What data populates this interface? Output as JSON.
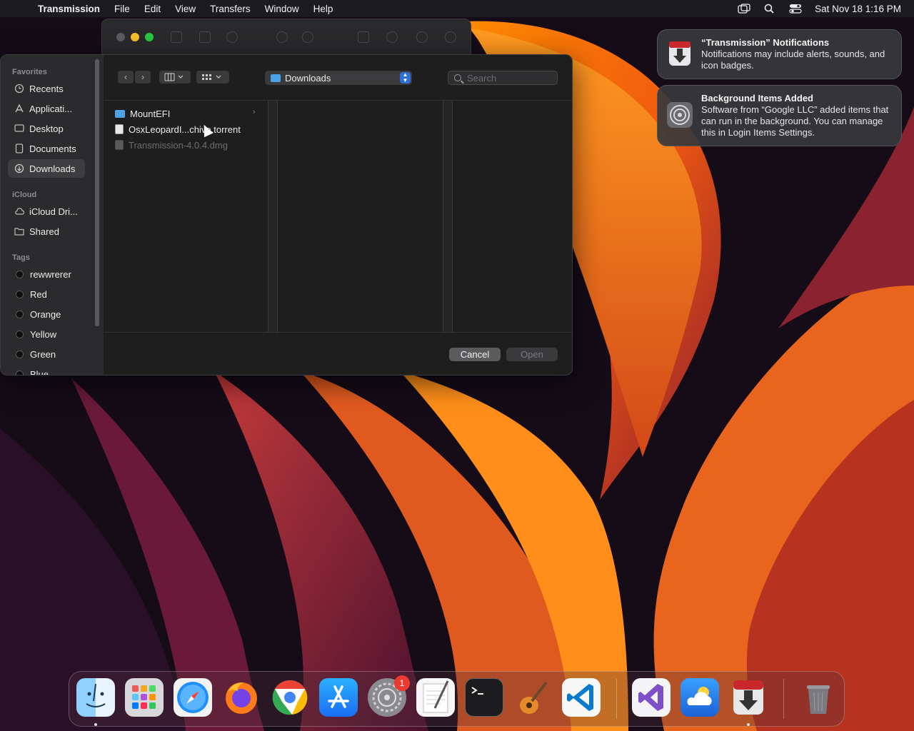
{
  "menubar": {
    "app_name": "Transmission",
    "items": [
      "File",
      "Edit",
      "View",
      "Transfers",
      "Window",
      "Help"
    ],
    "clock": "Sat Nov 18  1:16 PM"
  },
  "sidebar": {
    "favorites_title": "Favorites",
    "favorites": [
      "Recents",
      "Applicati...",
      "Desktop",
      "Documents",
      "Downloads"
    ],
    "icloud_title": "iCloud",
    "icloud": [
      "iCloud Dri...",
      "Shared"
    ],
    "tags_title": "Tags",
    "tags": [
      "rewwrerer",
      "Red",
      "Orange",
      "Yellow",
      "Green",
      "Blue"
    ]
  },
  "toolbar": {
    "location": "Downloads",
    "search_placeholder": "Search"
  },
  "files": [
    {
      "name": "MountEFI",
      "kind": "folder"
    },
    {
      "name": "OsxLeopardI...chive.torrent",
      "kind": "document"
    },
    {
      "name": "Transmission-4.0.4.dmg",
      "kind": "disabled"
    }
  ],
  "buttons": {
    "cancel": "Cancel",
    "open": "Open"
  },
  "notifications": [
    {
      "title": "“Transmission” Notifications",
      "body": "Notifications may include alerts, sounds, and icon badges."
    },
    {
      "title": "Background Items Added",
      "body": "Software from “Google LLC” added items that can run in the background. You can manage this in Login Items Settings."
    }
  ],
  "dock": {
    "apps": [
      "Finder",
      "Launchpad",
      "Safari",
      "Firefox",
      "Chrome",
      "App Store",
      "System Settings",
      "TextEdit",
      "Terminal",
      "GarageBand",
      "Visual Studio Code",
      "Visual Studio",
      "Weather",
      "Transmission",
      "Trash"
    ],
    "settings_badge": "1"
  },
  "colors": {
    "accent": "#2f6fd8",
    "folder": "#4aa3e8",
    "badge": "#ea3b33"
  }
}
